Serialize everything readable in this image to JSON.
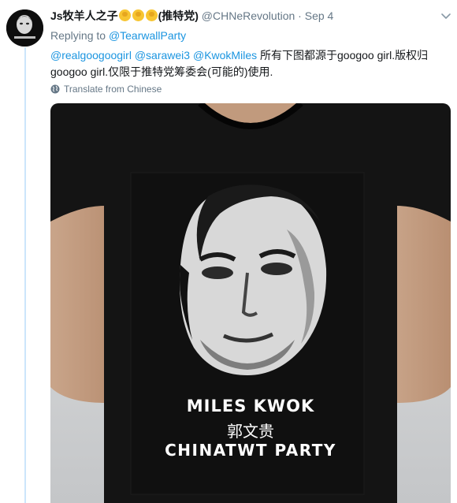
{
  "tweet": {
    "author_name": "Js牧羊人之子",
    "author_suffix": "(推特党)",
    "emojis": [
      "raised-fist-emoji",
      "raised-fist-emoji",
      "raised-fist-emoji"
    ],
    "handle": "@CHNeRevolution",
    "separator": "·",
    "date": "Sep 4",
    "replying_prefix": "Replying to",
    "replying_to": "@TearwallParty",
    "mentions": [
      "@realgoogoogirl",
      "@sarawei3",
      "@KwokMiles"
    ],
    "text_line1": "所有下图都源于googoo girl.版权归",
    "text_line2": "googoo girl.仅限于推特党筹委会(可能的)使用.",
    "translate_label": "Translate from Chinese"
  },
  "media": {
    "shirt_line1": "MILES KWOK",
    "shirt_line2": "郭文贵",
    "shirt_line3": "CHINATWT PARTY"
  },
  "colors": {
    "link": "#1b95e0",
    "muted": "#657786",
    "thread_line": "#cce6fb",
    "shirt": "#141414"
  }
}
